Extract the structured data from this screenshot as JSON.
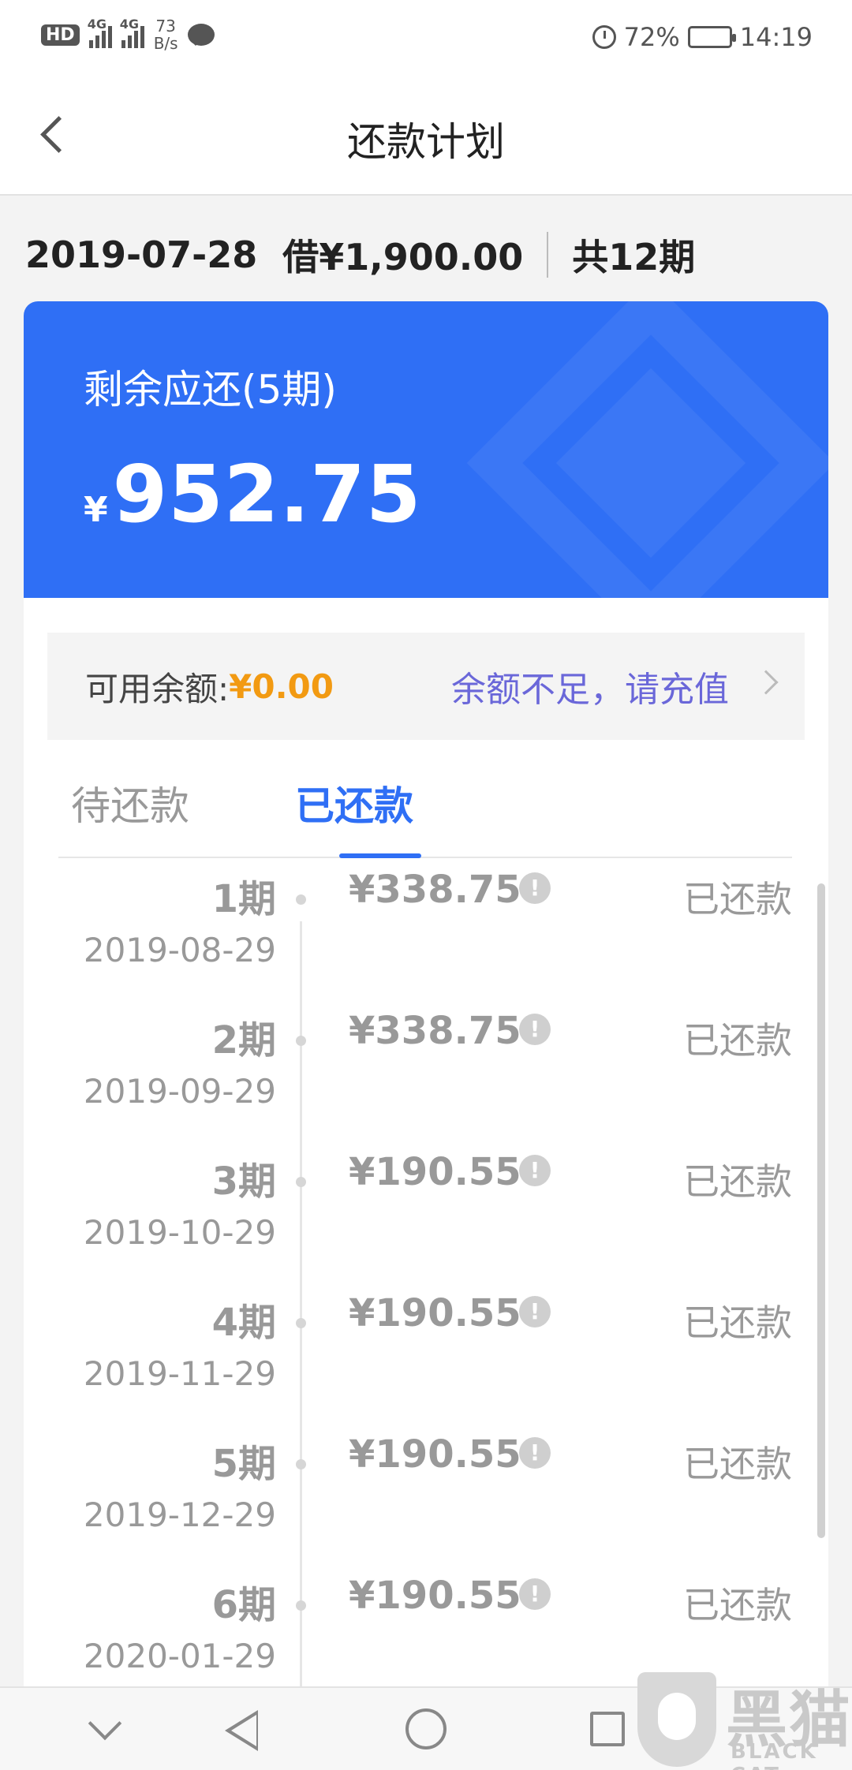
{
  "status_bar": {
    "hd_label": "HD",
    "signal1_label": "4G",
    "signal2_label": "4G",
    "net_speed_value": "73",
    "net_speed_unit": "B/s",
    "battery": "72%",
    "battery_level": 0.72,
    "time": "14:19"
  },
  "nav": {
    "title": "还款计划"
  },
  "loan": {
    "date": "2019-07-28",
    "borrowed": "借¥1,900.00",
    "periods": "共12期"
  },
  "card": {
    "label": "剩余应还(5期)",
    "currency": "¥",
    "amount": "952.75"
  },
  "balance": {
    "label": "可用余额:",
    "amount": "¥0.00",
    "recharge_text": "余额不足，请充值"
  },
  "tabs": [
    {
      "label": "待还款",
      "active": false
    },
    {
      "label": "已还款",
      "active": true
    }
  ],
  "installments": [
    {
      "period": "1期",
      "date": "2019-08-29",
      "amount": "¥338.75",
      "status": "已还款"
    },
    {
      "period": "2期",
      "date": "2019-09-29",
      "amount": "¥338.75",
      "status": "已还款"
    },
    {
      "period": "3期",
      "date": "2019-10-29",
      "amount": "¥190.55",
      "status": "已还款"
    },
    {
      "period": "4期",
      "date": "2019-11-29",
      "amount": "¥190.55",
      "status": "已还款"
    },
    {
      "period": "5期",
      "date": "2019-12-29",
      "amount": "¥190.55",
      "status": "已还款"
    },
    {
      "period": "6期",
      "date": "2020-01-29",
      "amount": "¥190.55",
      "status": "已还款"
    }
  ],
  "watermark": {
    "cn": "黑猫",
    "en": "BLACK CAT"
  },
  "colors": {
    "primary": "#2f6ff5",
    "balance_amount": "#f29a12",
    "recharge_link": "#6a67d9"
  },
  "icons": [
    "back-arrow-icon",
    "alarm-icon",
    "battery-icon",
    "chat-bubble-icon",
    "chevron-right-icon",
    "info-icon",
    "nav-down-icon",
    "nav-back-icon",
    "nav-home-icon",
    "nav-recent-icon"
  ]
}
